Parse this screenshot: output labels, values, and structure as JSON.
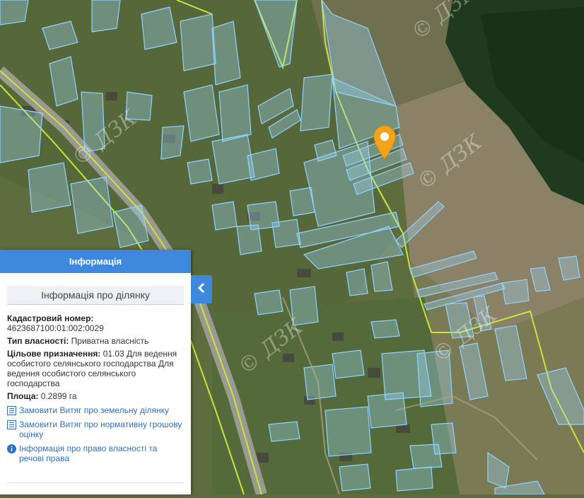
{
  "map": {
    "watermark_text": "© ДЗК",
    "parcel_stroke_color": "#8fd3ff",
    "parcel_fill_color": "#9fd8f5",
    "boundary_color": "#c6e63a",
    "marker_color": "#f5a31a",
    "marker_icon": "map-pin-icon"
  },
  "panel": {
    "header_title": "Інформація",
    "section_title": "Інформація про ділянку",
    "cadastral_label": "Кадастровий номер:",
    "cadastral_value": "4623687100:01:002:0029",
    "ownership_label": "Тип власності:",
    "ownership_value": "Приватна власність",
    "purpose_label": "Цільове призначення:",
    "purpose_value": "01.03 Для ведення особистого селянського господарства Для ведення особистого селянського господарства",
    "area_label": "Площа:",
    "area_value": "0.2899 га",
    "links": [
      {
        "label": "Замовити Витяг про земельну ділянку",
        "icon": "document-list-icon"
      },
      {
        "label": "Замовити Витяг про нормативну грошову оцінку",
        "icon": "document-list-icon"
      },
      {
        "label": "Інформація про право власності та речові права",
        "icon": "info-circle-icon"
      }
    ],
    "collapse_icon": "chevron-left-icon"
  }
}
